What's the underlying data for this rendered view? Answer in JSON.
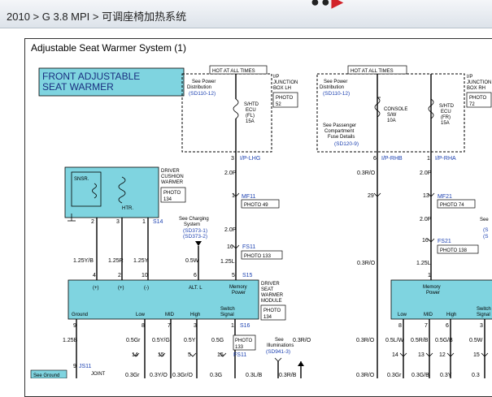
{
  "breadcrumb": {
    "year": "2010",
    "sep1": ">",
    "engine": "G 3.8 MPI",
    "sep2": ">",
    "section": "可调座椅加热系统"
  },
  "diagram": {
    "title": "Adjustable Seat Warmer System (1)",
    "system_label": [
      "FRONT ADJUSTABLE",
      "SEAT WARMER"
    ],
    "left_box": {
      "hot": "HOT AT ALL TIMES",
      "power": [
        "See Power",
        "Distribution"
      ],
      "power_ref": "(SD110-12)",
      "fuse": [
        "S/HTD",
        "ECU",
        "(FL)",
        "15A"
      ],
      "jbox": [
        "I/P",
        "JUNCTION",
        "BOX LH"
      ],
      "photo": [
        "PHOTO",
        "52"
      ]
    },
    "right_box": {
      "hot": "HOT AT ALL TIMES",
      "power": [
        "See Power",
        "Distribution"
      ],
      "power_ref": "(SD110-12)",
      "console": [
        "CONSOLE",
        "S/W",
        "10A"
      ],
      "fuse": [
        "S/HTD",
        "ECU",
        "(FR)",
        "15A"
      ],
      "pass": [
        "See Passenger",
        "Compartment",
        "Fuse Details"
      ],
      "pass_ref": "(SD120-9)",
      "jbox": [
        "I/P",
        "JUNCTION",
        "BOX RH"
      ],
      "photo": [
        "PHOTO",
        "72"
      ]
    },
    "cushion": {
      "sensor": "SNSR.",
      "heater": "HTR.",
      "label": [
        "DRIVER",
        "CUSHION",
        "WARMER"
      ],
      "photo": [
        "PHOTO",
        "134"
      ],
      "pins": [
        "2",
        "3",
        "1"
      ],
      "conn": "S14"
    },
    "charging": {
      "text": [
        "See Charging",
        "System"
      ],
      "refs": [
        "(SD373-1)",
        "(SD373-2)"
      ]
    },
    "module_left": {
      "pins_top": [
        "4",
        "2",
        "10",
        "6",
        "5"
      ],
      "conn_top": "S15",
      "labels": [
        "(+)",
        "(+)",
        "(-)",
        "ALT. L",
        "Memory",
        "Power",
        "Ground",
        "Low",
        "MID",
        "High",
        "Switch",
        "Signal"
      ],
      "name": [
        "DRIVER",
        "SEAT",
        "WARMER",
        "MODULE"
      ],
      "photo": [
        "PHOTO",
        "134"
      ],
      "pins_bot": [
        "9",
        "8",
        "7",
        "3",
        "1"
      ],
      "conn_bot": "S16"
    },
    "module_right": {
      "labels": [
        "Memory",
        "Power",
        "Low",
        "MID",
        "High",
        "Switch",
        "Signal"
      ]
    },
    "wires_left": {
      "lhg_pin": "3",
      "lhg": "I/P-LHG",
      "w1": "2.0P",
      "mf11_pin": "1",
      "mf11": "MF11",
      "photo49": "PHOTO 49",
      "w2": "2.0P",
      "fs11_pin": "16",
      "fs11": "FS11",
      "photo133": "PHOTO 133",
      "w3": "1.25L",
      "cushion_wires": [
        "1.25Y/B",
        "1.25R",
        "1.25Y"
      ],
      "alt_wire": "0.5W",
      "bot_wires": [
        "1.25B",
        "0.5Gr",
        "0.5Y/G",
        "0.5Y",
        "0.5G"
      ],
      "bot_pins": [
        "14",
        "15",
        "5",
        "15"
      ],
      "photo133b": [
        "PHOTO",
        "133"
      ],
      "fs11b": "FS11",
      "illum": [
        "See",
        "Illuminations"
      ],
      "illum_ref": "(SD941-3)",
      "illum_wire": "0.3R/O",
      "bot_wires2": [
        "0.3Gr",
        "0.3Y/O",
        "0.3Gr/O",
        "0.3G",
        "0.3L/B",
        "0.3R/B"
      ],
      "js11_pin": "9",
      "js11": "JS11",
      "joint": "JOINT",
      "see_ground": "See Ground"
    },
    "wires_right": {
      "rhb_pin": "6",
      "rhb": "I/P-RHB",
      "rha_pin": "1",
      "rha": "I/P-RHA",
      "w_ro": "0.3R/O",
      "w_p": "2.0P",
      "mf21_pins": [
        "29",
        "13"
      ],
      "mf21": "MF21",
      "photo74": "PHOTO 74",
      "w2": "2.0P",
      "fs21_pin": "16",
      "fs21": "FS21",
      "photo138": "PHOTO 138",
      "w3": "1.25L",
      "pin1": "1",
      "see": "See",
      "refs": [
        "(S",
        "(S"
      ],
      "bot_pins": [
        "8",
        "7",
        "6",
        "3"
      ],
      "bot_wires": [
        "0.3R/O",
        "0.5L/W",
        "0.5R/B",
        "0.5G/B",
        "0.5W"
      ],
      "bot_pins2": [
        "14",
        "13",
        "12",
        "15"
      ],
      "bot_wires2": [
        "0.3R/O",
        "0.3Gr",
        "0.3G/B",
        "0.3Y",
        "0.3"
      ]
    }
  }
}
